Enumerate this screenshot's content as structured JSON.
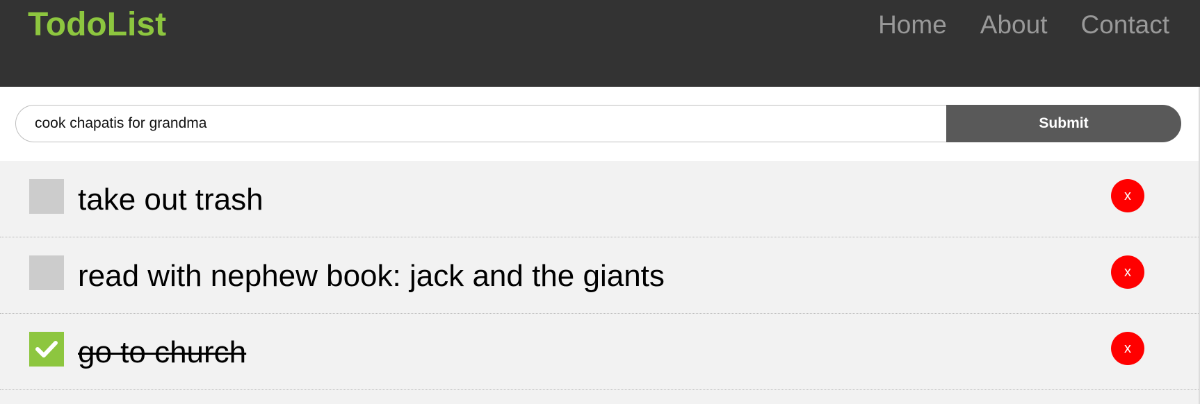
{
  "header": {
    "brand": "TodoList",
    "nav": [
      {
        "label": "Home"
      },
      {
        "label": "About"
      },
      {
        "label": "Contact"
      }
    ]
  },
  "form": {
    "input_value": "cook chapatis for grandma",
    "submit_label": "Submit"
  },
  "todos": [
    {
      "text": "take out trash",
      "completed": false,
      "delete_label": "x"
    },
    {
      "text": "read with nephew book: jack and the giants",
      "completed": false,
      "delete_label": "x"
    },
    {
      "text": "go to church",
      "completed": true,
      "delete_label": "x"
    }
  ],
  "colors": {
    "navbar_bg": "#333333",
    "brand": "#8dc63f",
    "nav_link": "#999999",
    "submit_bg": "#595959",
    "list_bg": "#f2f2f2",
    "checkbox_unchecked": "#cccccc",
    "checkbox_checked": "#8dc63f",
    "delete_bg": "#ff0000"
  },
  "icons": {
    "checkmark": "check-icon",
    "delete": "close-icon"
  }
}
